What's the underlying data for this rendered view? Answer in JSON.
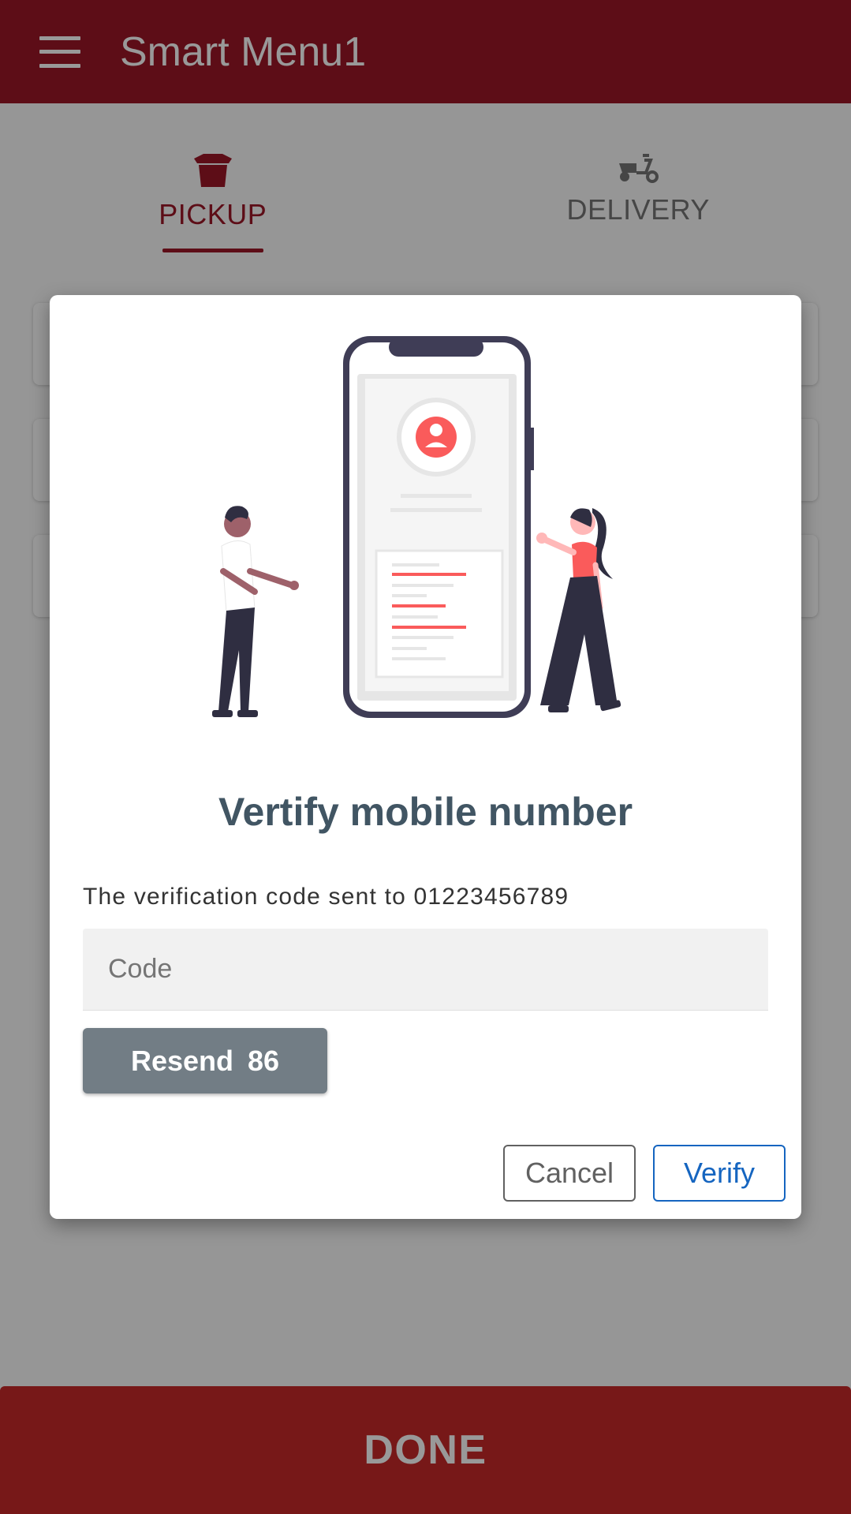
{
  "app": {
    "title": "Smart Menu1"
  },
  "tabs": [
    {
      "label": "PICKUP",
      "icon": "takeout-box-icon",
      "active": true
    },
    {
      "label": "DELIVERY",
      "icon": "scooter-icon",
      "active": false
    }
  ],
  "done": {
    "label": "DONE"
  },
  "dialog": {
    "illustration": "verify-phone-illustration",
    "title": "Vertify mobile number",
    "message": "The verification code sent to 01223456789",
    "code_placeholder": "Code",
    "code_value": "",
    "resend_label": "Resend",
    "resend_countdown": "86",
    "cancel_label": "Cancel",
    "verify_label": "Verify"
  },
  "colors": {
    "primary": "#9b1627",
    "done_bar": "#c62828",
    "title_text": "#415563",
    "resend_bg": "#727d85",
    "verify_accent": "#1565c0",
    "illustration_accent": "#fa5b5b",
    "illustration_dark": "#2f2e41"
  }
}
